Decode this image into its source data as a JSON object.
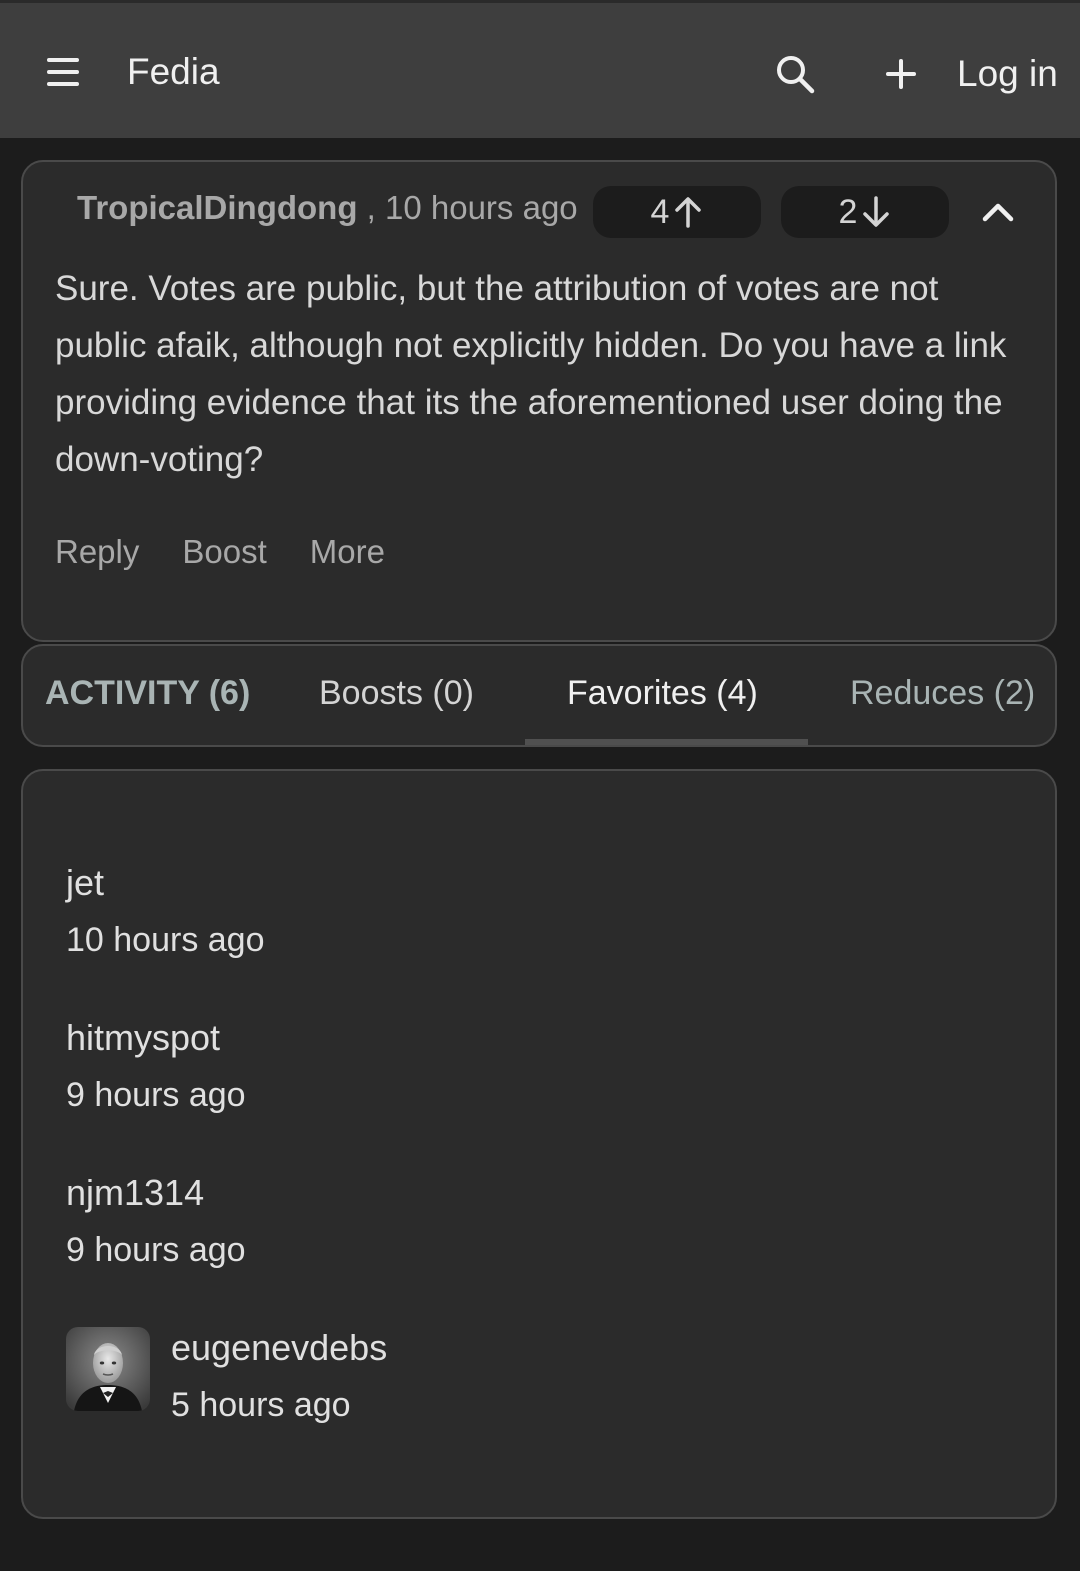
{
  "header": {
    "brand": "Fedia",
    "login_label": "Log in"
  },
  "comment": {
    "author": "TropicalDingdong",
    "separator": ",",
    "time": "10 hours ago",
    "upvotes": "4",
    "downvotes": "2",
    "body": "Sure. Votes are public, but the attribution of votes are not public afaik, although not explicitly hidden. Do you have a link providing evidence that its the aforementioned user doing the down-voting?",
    "actions": {
      "reply": "Reply",
      "boost": "Boost",
      "more": "More"
    }
  },
  "tabs": {
    "activity": "ACTIVITY (6)",
    "boosts": "Boosts (0)",
    "favorites": "Favorites (4)",
    "reduces": "Reduces (2)",
    "active": "favorites"
  },
  "favorites": [
    {
      "name": "jet",
      "time": "10 hours ago"
    },
    {
      "name": "hitmyspot",
      "time": "9 hours ago"
    },
    {
      "name": "njm1314",
      "time": "9 hours ago"
    },
    {
      "name": "eugenevdebs",
      "time": "5 hours ago",
      "has_avatar": true
    }
  ],
  "colors": {
    "background": "#1c1c1c",
    "header": "#3e3e3e",
    "card": "#2b2b2b",
    "border": "#4a4a4a"
  },
  "icons": [
    "menu-icon",
    "search-icon",
    "plus-icon",
    "arrow-up-icon",
    "arrow-down-icon",
    "chevron-up-icon",
    "avatar-portrait"
  ]
}
